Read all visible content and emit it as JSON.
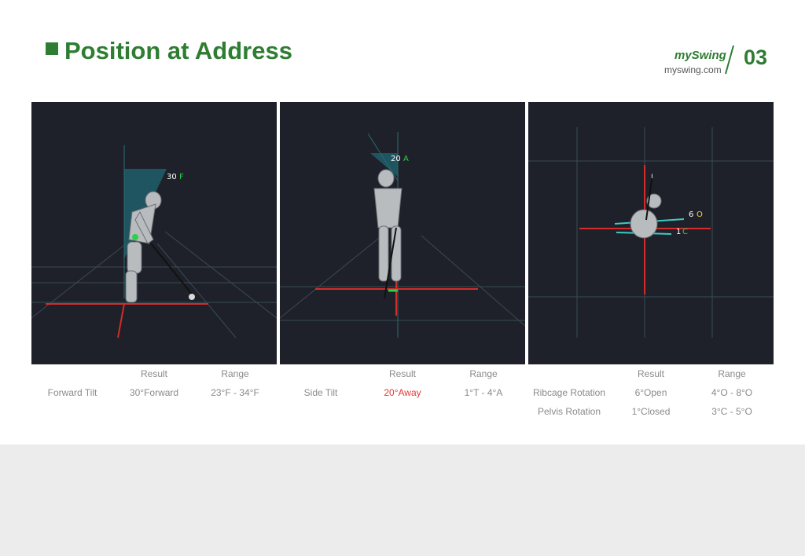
{
  "header": {
    "title": "Position at Address",
    "logo_text": "mySwing",
    "site_url": "myswing.com",
    "page_number": "03"
  },
  "panels": [
    {
      "overlay_value": "30",
      "overlay_unit": "F",
      "result_header": "Result",
      "range_header": "Range",
      "metrics": [
        {
          "name": "Forward Tilt",
          "result": "30°Forward",
          "range": "23°F - 34°F",
          "out_of_range": false
        }
      ]
    },
    {
      "overlay_value": "20",
      "overlay_unit": "A",
      "result_header": "Result",
      "range_header": "Range",
      "metrics": [
        {
          "name": "Side Tilt",
          "result": "20°Away",
          "range": "1°T - 4°A",
          "out_of_range": true
        }
      ]
    },
    {
      "overlay_value_1": "6",
      "overlay_unit_1": "O",
      "overlay_value_2": "1",
      "overlay_unit_2": "C",
      "result_header": "Result",
      "range_header": "Range",
      "metrics": [
        {
          "name": "Ribcage Rotation",
          "result": "6°Open",
          "range": "4°O - 8°O",
          "out_of_range": false
        },
        {
          "name": "Pelvis Rotation",
          "result": "1°Closed",
          "range": "3°C - 5°O",
          "out_of_range": false
        }
      ]
    }
  ],
  "colors": {
    "brand_green": "#2e7d32",
    "panel_bg": "#1e2129",
    "alert_red": "#e53935",
    "label_gray": "#8a8a8a"
  }
}
